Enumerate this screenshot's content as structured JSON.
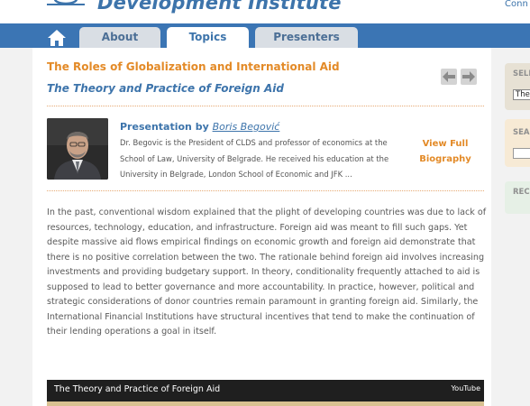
{
  "header": {
    "site_title": "Development Institute",
    "top_link": "Conn"
  },
  "nav": {
    "home_icon": "home-icon",
    "tabs": [
      {
        "label": "About",
        "active": false
      },
      {
        "label": "Topics",
        "active": true
      },
      {
        "label": "Presenters",
        "active": false
      }
    ]
  },
  "topic": {
    "title": "The Roles of Globalization and International Aid",
    "subtitle": "The Theory and Practice of Foreign Aid",
    "prev_icon": "arrow-left-icon",
    "next_icon": "arrow-right-icon"
  },
  "presenter": {
    "prefix": "Presentation by ",
    "name": "Boris Begović",
    "bio_lines": [
      "Dr. Begovic is the President of CLDS and professor of economics at the",
      "School of Law, University of Belgrade. He received his education at the",
      "University in Belgrade, London School of Economic and JFK ..."
    ],
    "view_bio_line1": "View Full",
    "view_bio_line2": "Biography"
  },
  "body_text": "In the past, conventional wisdom explained that the plight of developing countries was due to lack of resources, technology, education, and infrastructure. Foreign aid was meant to fill such gaps. Yet despite massive aid flows empirical findings on economic growth and foreign aid demonstrate that there is no positive correlation between the two. The rationale behind foreign aid involves increasing investments and providing budgetary support. In theory, conditionality frequently attached to aid is supposed to lead to better governance and more accountability. In practice, however, political and strategic considerations of donor countries remain paramount in granting foreign aid. Similarly, the International Financial Institutions have structural incentives that tend to make the continuation of their lending operations a goal in itself.",
  "video": {
    "title": "The Theory and Practice of Foreign Aid",
    "source": "YouTube"
  },
  "sidebar": {
    "panel1_label": "SELE",
    "panel1_select": "The",
    "panel2_label": "SEAR",
    "panel3_label": "REC"
  },
  "colors": {
    "nav_blue": "#3b75b4",
    "title_orange": "#e38a27",
    "link_blue": "#3d74ab"
  }
}
